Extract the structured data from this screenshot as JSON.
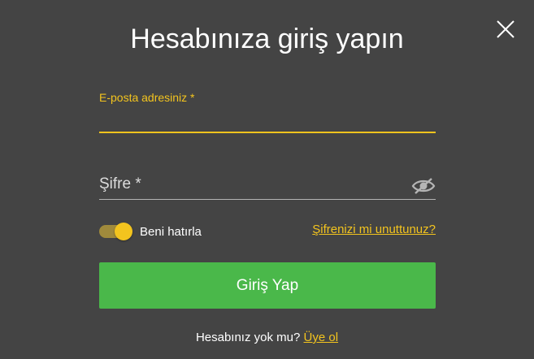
{
  "modal": {
    "title": "Hesabınıza giriş yapın",
    "close_icon": "close-icon"
  },
  "form": {
    "email": {
      "label": "E-posta adresiniz *",
      "value": ""
    },
    "password": {
      "placeholder": "Şifre *",
      "value": "",
      "visibility_icon": "eye-slash-icon"
    },
    "remember": {
      "label": "Beni hatırla",
      "checked": true
    },
    "forgot_link": "Şifrenizi mi unuttunuz?",
    "submit_label": "Giriş Yap"
  },
  "signup": {
    "prompt": "Hesabınız yok mu?",
    "link": "Üye ol"
  },
  "colors": {
    "background": "#444444",
    "accent": "#f3c41e",
    "primary_button": "#4ab84a",
    "text": "#ffffff"
  }
}
